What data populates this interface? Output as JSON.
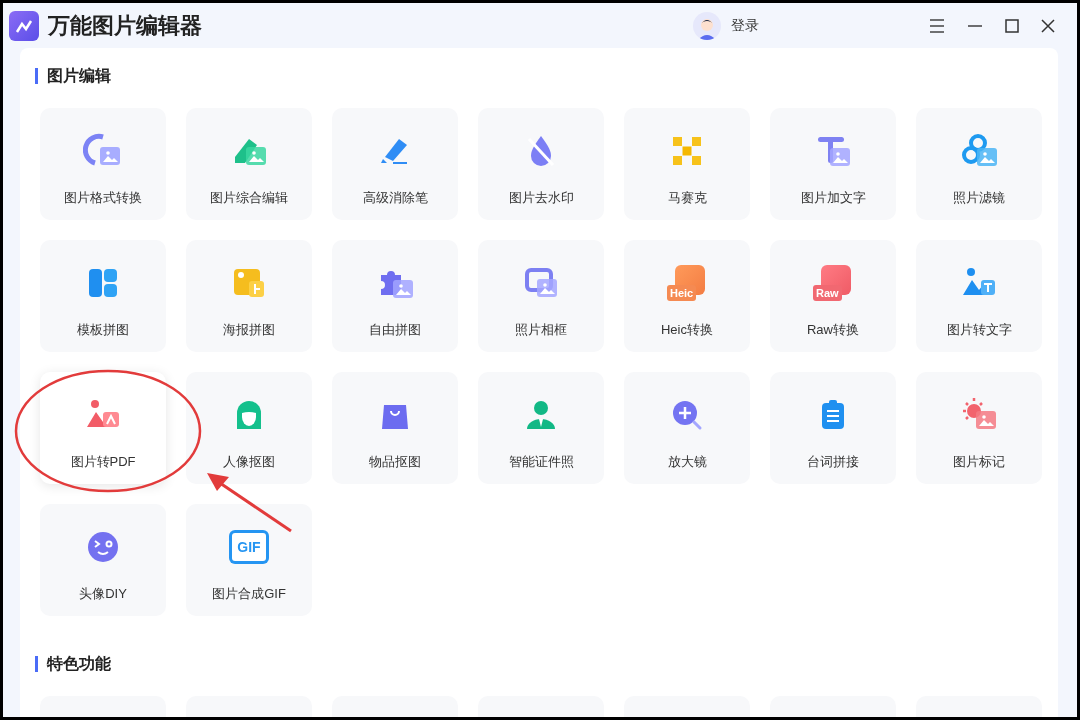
{
  "window": {
    "title": "万能图片编辑器"
  },
  "account": {
    "label": "登录"
  },
  "sections": [
    {
      "title": "图片编辑",
      "tiles": [
        {
          "label": "图片格式转换",
          "selected": false
        },
        {
          "label": "图片综合编辑",
          "selected": false
        },
        {
          "label": "高级消除笔",
          "selected": false
        },
        {
          "label": "图片去水印",
          "selected": false
        },
        {
          "label": "马赛克",
          "selected": false
        },
        {
          "label": "图片加文字",
          "selected": false
        },
        {
          "label": "照片滤镜",
          "selected": false
        },
        {
          "label": "模板拼图",
          "selected": false
        },
        {
          "label": "海报拼图",
          "selected": false
        },
        {
          "label": "自由拼图",
          "selected": false
        },
        {
          "label": "照片相框",
          "selected": false
        },
        {
          "label": "Heic转换",
          "selected": false,
          "icon_text": "Heic"
        },
        {
          "label": "Raw转换",
          "selected": false,
          "icon_text": "Raw"
        },
        {
          "label": "图片转文字",
          "selected": false
        },
        {
          "label": "图片转PDF",
          "selected": true
        },
        {
          "label": "人像抠图",
          "selected": false
        },
        {
          "label": "物品抠图",
          "selected": false
        },
        {
          "label": "智能证件照",
          "selected": false
        },
        {
          "label": "放大镜",
          "selected": false
        },
        {
          "label": "台词拼接",
          "selected": false
        },
        {
          "label": "图片标记",
          "selected": false
        },
        {
          "label": "头像DIY",
          "selected": false
        },
        {
          "label": "图片合成GIF",
          "selected": false,
          "icon_text": "GIF"
        }
      ]
    },
    {
      "title": "特色功能"
    }
  ]
}
